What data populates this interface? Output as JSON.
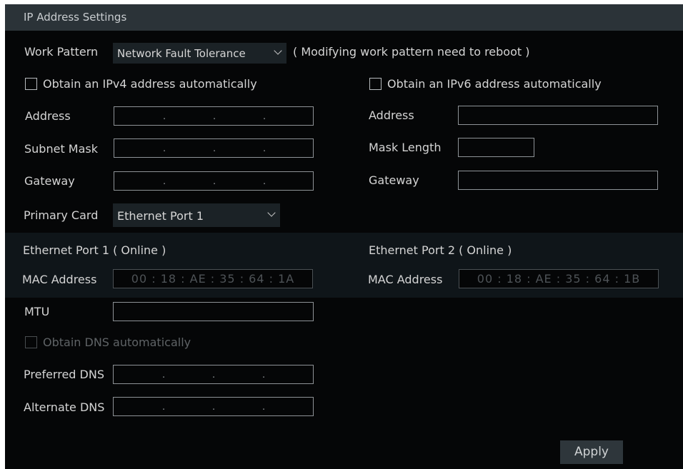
{
  "title": "IP Address Settings",
  "work_pattern": {
    "label": "Work Pattern",
    "value": "Network Fault Tolerance",
    "note": "( Modifying work pattern need to reboot )"
  },
  "ipv4": {
    "auto_label": "Obtain an IPv4 address automatically",
    "address_label": "Address",
    "subnet_label": "Subnet Mask",
    "gateway_label": "Gateway",
    "primary_card_label": "Primary Card",
    "primary_card_value": "Ethernet Port 1"
  },
  "ipv6": {
    "auto_label": "Obtain an IPv6 address automatically",
    "address_label": "Address",
    "mask_length_label": "Mask Length",
    "gateway_label": "Gateway"
  },
  "port1": {
    "heading": "Ethernet Port 1 ( Online )",
    "mac_label": "MAC Address",
    "mac_value": "00 : 18 : AE : 35 : 64 : 1A",
    "mtu_label": "MTU",
    "dns_auto_label": "Obtain DNS automatically",
    "preferred_dns_label": "Preferred DNS",
    "alternate_dns_label": "Alternate DNS"
  },
  "port2": {
    "heading": "Ethernet Port 2 ( Online )",
    "mac_label": "MAC Address",
    "mac_value": "00 : 18 : AE : 35 : 64 : 1B"
  },
  "dot": ".",
  "apply_label": "Apply",
  "colors": {
    "panel_bg": "#050607",
    "title_bar": "#2b3338",
    "section_band": "#0f1519",
    "button_bg": "#2e363b"
  }
}
